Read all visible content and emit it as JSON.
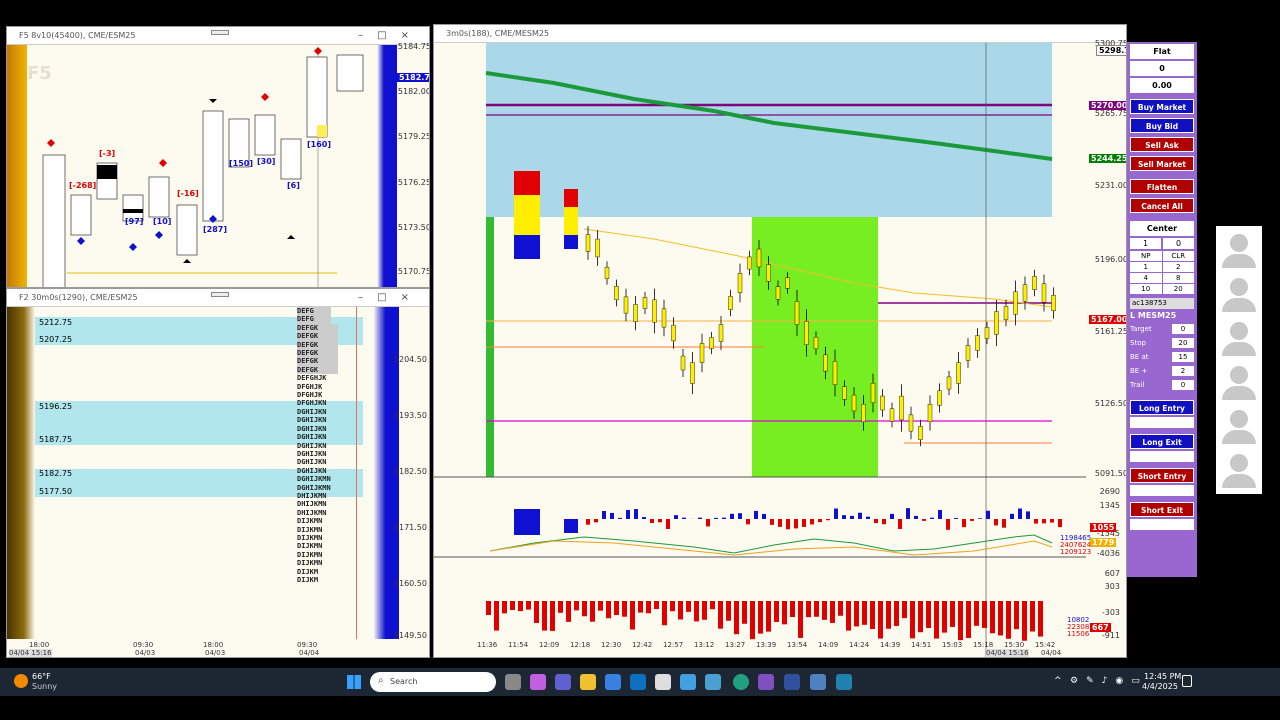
{
  "win_f5": {
    "title": "F5 8v10(45400), CME/ESM25",
    "watermark": "F5",
    "prices": [
      "5184.75",
      "5182.00",
      "5179.25",
      "5176.25",
      "5173.50",
      "5170.75"
    ],
    "current_tag": "5182.75",
    "deltas": [
      {
        "text": "[-268]",
        "color": "#e00000"
      },
      {
        "text": "[-3]",
        "color": "#e00000"
      },
      {
        "text": "[97]",
        "color": "#1010d0"
      },
      {
        "text": "[10]",
        "color": "#1010d0"
      },
      {
        "text": "[-16]",
        "color": "#e00000"
      },
      {
        "text": "[287]",
        "color": "#1010d0"
      },
      {
        "text": "[150]",
        "color": "#1010d0"
      },
      {
        "text": "[30]",
        "color": "#1010d0"
      },
      {
        "text": "[6]",
        "color": "#1010d0"
      },
      {
        "text": "[160]",
        "color": "#1010d0"
      }
    ]
  },
  "win_f2": {
    "title": "F2 30m0s(1290), CME/ESM25",
    "levels": [
      "5212.75",
      "5207.25",
      "5196.25",
      "5187.75",
      "5182.75",
      "5177.50"
    ],
    "prices": [
      "5204.50",
      "5193.50",
      "5182.50",
      "5171.50",
      "5160.50",
      "5149.50"
    ],
    "tpo_rows": [
      "DEFG",
      "DEFG",
      "DEFGK",
      "DEFGK",
      "DEFGK",
      "DEFGK",
      "DEFGK",
      "DEFGK",
      "DEFGHJK",
      "DFGHJK",
      "DFGHJK",
      "DFGHJKN",
      "DGHIJKN",
      "DGHIJKN",
      "DGHIJKN",
      "DGHIJKN",
      "DGHIJKN",
      "DGHIJKN",
      "DGHIJKN",
      "DGHIJKN",
      "DGHIJKMN",
      "DGHIJKMN",
      "DHIJKMN",
      "DHIJKMN",
      "DHIJKMN",
      "DIJKMN",
      "DIJKMN",
      "DIJKMN",
      "DIJKMN",
      "DIJKMN",
      "DIJKMN",
      "DIJKM",
      "DIJKM"
    ],
    "x_labels": [
      "18:00",
      "09:30",
      "18:00",
      "09:30"
    ],
    "x_dates": [
      "04/03",
      "04/03",
      "04/04"
    ],
    "status": "04/04 15:16"
  },
  "win_main": {
    "title": "3m0s(188), CME/MESM25",
    "prices": [
      "5300.75",
      "5265.75",
      "5231.00",
      "5196.00",
      "5161.25",
      "5126.50",
      "5091.50"
    ],
    "tags": [
      {
        "text": "5298.75",
        "bg": "#ffffff",
        "fg": "#000"
      },
      {
        "text": "5270.00",
        "bg": "#800080",
        "fg": "#fff"
      },
      {
        "text": "5244.25",
        "bg": "#008000",
        "fg": "#fff"
      },
      {
        "text": "5167.00",
        "bg": "#e00000",
        "fg": "#fff"
      }
    ],
    "osc1_axis": [
      "2690",
      "1345",
      "-1345",
      "-4036"
    ],
    "osc1_tags": [
      "1055",
      "1198465",
      "2407624",
      "1209123",
      "1779"
    ],
    "osc2_axis": [
      "607",
      "303",
      "-303",
      "-911"
    ],
    "osc2_tags": [
      "10802",
      "22308",
      "11506",
      "667"
    ],
    "times": [
      "11:36",
      "11:54",
      "12:09",
      "12:18",
      "12:30",
      "12:42",
      "12:57",
      "13:12",
      "13:27",
      "13:39",
      "13:54",
      "14:09",
      "14:24",
      "14:39",
      "14:51",
      "15:03",
      "15:18",
      "15:30",
      "15:42"
    ],
    "date_label": "04/04",
    "cursor_time": "04/04 15:16"
  },
  "panel": {
    "status": "Flat",
    "qty": "0",
    "pnl": "0.00",
    "buttons": [
      {
        "label": "Buy Market",
        "color": "#1010c0"
      },
      {
        "label": "Buy Bid",
        "color": "#1010c0"
      },
      {
        "label": "Sell Ask",
        "color": "#b00000"
      },
      {
        "label": "Sell Market",
        "color": "#b00000"
      }
    ],
    "flatten": "Flatten",
    "cancel_all": "Cancel All",
    "center": "Center",
    "qty_input": "1",
    "qty_right": "0",
    "np": "NP",
    "clr": "CLR",
    "grid": [
      "1",
      "2",
      "4",
      "8",
      "10",
      "20"
    ],
    "account": "ac138753",
    "symbol": "L MESM25",
    "fields": [
      {
        "label": "Target",
        "value": "0"
      },
      {
        "label": "Stop",
        "value": "20"
      },
      {
        "label": "BE at",
        "value": "15"
      },
      {
        "label": "BE +",
        "value": "2"
      },
      {
        "label": "Trail",
        "value": "0"
      }
    ],
    "actions": [
      {
        "label": "Long Entry",
        "color": "#1010c0"
      },
      {
        "label": "Long Exit",
        "color": "#1010c0"
      },
      {
        "label": "Short Entry",
        "color": "#b00000"
      },
      {
        "label": "Short Exit",
        "color": "#b00000"
      }
    ]
  },
  "taskbar": {
    "weather_temp": "66°F",
    "weather_text": "Sunny",
    "search_placeholder": "Search",
    "time": "12:45 PM",
    "date": "4/4/2025"
  }
}
